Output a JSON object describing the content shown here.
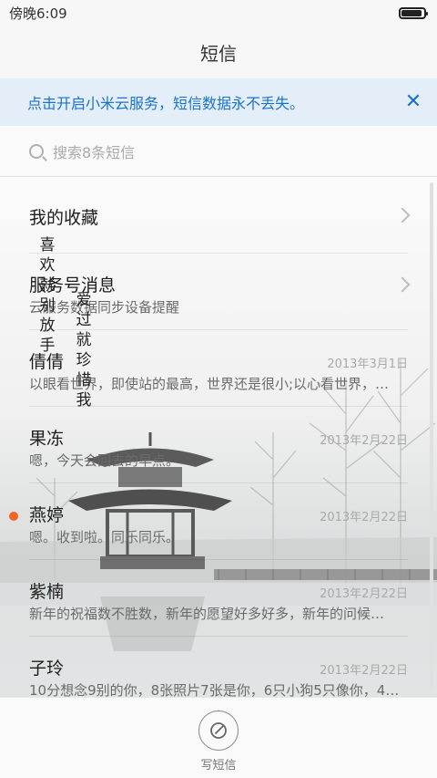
{
  "status": {
    "time": "傍晚6:09",
    "battery_level": 0.9
  },
  "header": {
    "title": "短信"
  },
  "banner": {
    "text": "点击开启小米云服务，短信数据永不丢失。",
    "close_icon": "close-icon"
  },
  "search": {
    "placeholder": "搜索8条短信"
  },
  "conversations": [
    {
      "name": "我的收藏",
      "preview": "",
      "date": "",
      "chevron": true,
      "unread": false
    },
    {
      "name": "服务号消息",
      "preview": "云服务数据同步设备提醒",
      "date": "",
      "chevron": true,
      "unread": false
    },
    {
      "name": "倩倩",
      "preview": "以眼看世界，即使站的最高，世界还是很小;以心看世界，…",
      "date": "2013年3月1日",
      "chevron": false,
      "unread": false
    },
    {
      "name": "果冻",
      "preview": "嗯，今天会回去的早点。",
      "date": "2013年2月22日",
      "chevron": false,
      "unread": false
    },
    {
      "name": "燕婷",
      "preview": "嗯。收到啦。同乐同乐。",
      "date": "2013年2月22日",
      "chevron": false,
      "unread": true
    },
    {
      "name": "紫楠",
      "preview": "新年的祝福数不胜数，新年的愿望好多好多，新年的问候…",
      "date": "2013年2月22日",
      "chevron": false,
      "unread": false
    },
    {
      "name": "子玲",
      "preview": "10分想念9别的你，8张照片7张是你，6只小狗5只像你，4…",
      "date": "2013年2月22日",
      "chevron": false,
      "unread": false
    }
  ],
  "wallpaper_poem": {
    "column1": [
      "喜",
      "欢",
      "就",
      "别",
      "放",
      "手"
    ],
    "column2": [
      "爱",
      "过",
      "就",
      "珍",
      "惜",
      "我"
    ]
  },
  "compose": {
    "label": "写短信",
    "icon": "compose-icon"
  },
  "colors": {
    "accent": "#1a73c8",
    "unread_dot": "#f26522",
    "banner_bg": "#e4eef8"
  }
}
